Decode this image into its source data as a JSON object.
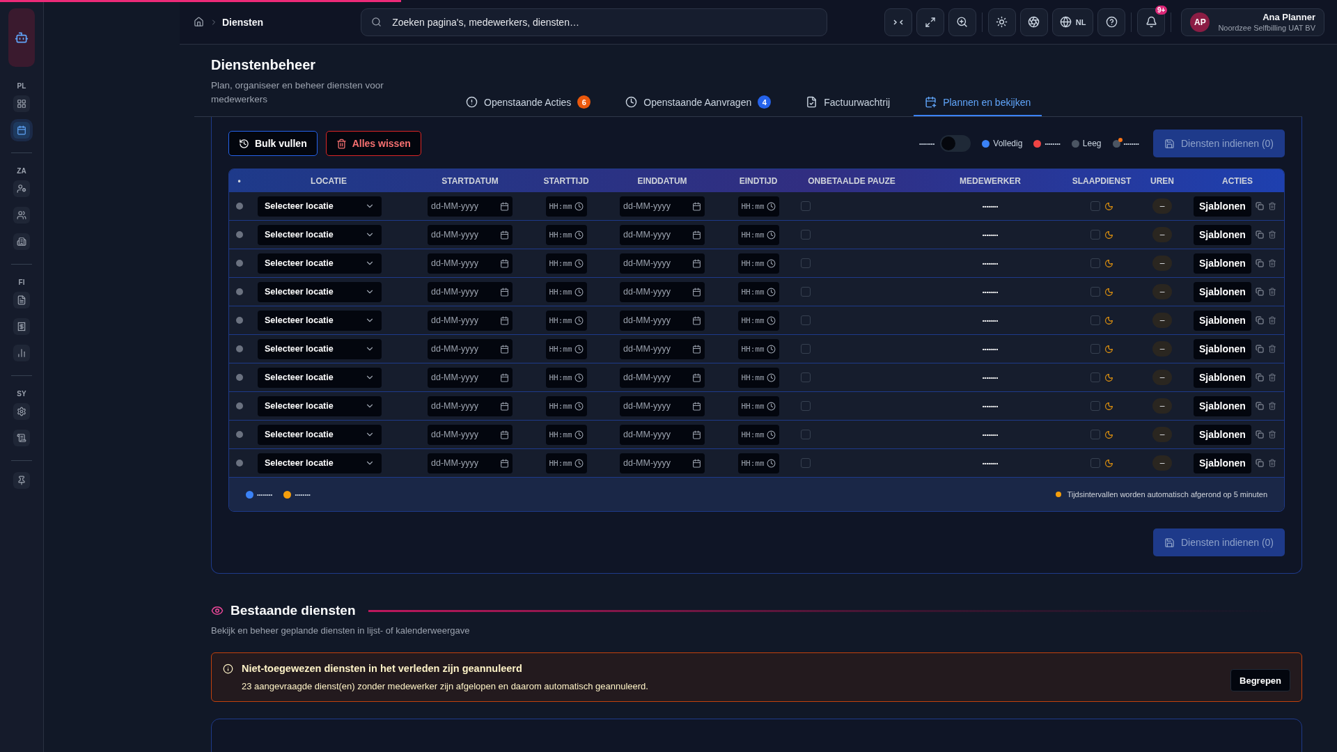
{
  "loading_bar": {
    "level": 0.3
  },
  "breadcrumb": {
    "current": "Diensten"
  },
  "search": {
    "placeholder": "Zoeken pagina's, medewerkers, diensten…"
  },
  "top_actions": {
    "language": "NL",
    "notification_badge": "9+"
  },
  "user": {
    "initials": "AP",
    "name": "Ana Planner",
    "company": "Noordzee Selfbilling UAT BV"
  },
  "sidebar": {
    "groups": [
      {
        "label": "PL",
        "items": [
          {
            "selected": false
          },
          {
            "selected": true
          }
        ]
      },
      {
        "label": "ZA",
        "items": [
          {
            "selected": false
          },
          {
            "selected": false
          },
          {
            "selected": false
          }
        ]
      },
      {
        "label": "FI",
        "items": [
          {
            "selected": false
          },
          {
            "selected": false
          },
          {
            "selected": false
          }
        ]
      },
      {
        "label": "SY",
        "items": [
          {
            "selected": false
          },
          {
            "selected": false
          }
        ]
      }
    ]
  },
  "page": {
    "title": "Dienstenbeheer",
    "subtitle": "Plan, organiseer en beheer diensten voor medewerkers"
  },
  "tabs": [
    {
      "label": "Openstaande Acties",
      "badge": "6",
      "color": "#ea580c",
      "selected": false
    },
    {
      "label": "Openstaande Aanvragen",
      "badge": "4",
      "color": "#2563eb",
      "selected": false
    },
    {
      "label": "Factuurwachtrij",
      "selected": false
    },
    {
      "label": "Plannen en bekijken",
      "selected": true
    }
  ],
  "planner": {
    "bulk_button": "Bulk vullen",
    "clear_button": "Alles wissen",
    "toggle": {
      "label": "••••••••",
      "on": false
    },
    "legend": [
      {
        "label": "Volledig",
        "color": "#3b82f6",
        "kind": "dot"
      },
      {
        "label": "••••••••",
        "color": "#ef4444",
        "kind": "dot"
      },
      {
        "label": "Leeg",
        "color": "#4b5563",
        "kind": "dot"
      },
      {
        "label": "••••••••",
        "color": "#4b5563",
        "kind": "flagged"
      }
    ],
    "submit_button": {
      "label": "Diensten indienen (0)",
      "disabled": true
    },
    "columns": [
      "•",
      "LOCATIE",
      "STARTDATUM",
      "STARTTIJD",
      "EINDDATUM",
      "EINDTIJD",
      "ONBETAALDE PAUZE",
      "MEDEWERKER",
      "SLAAPDIENST",
      "UREN",
      "ACTIES"
    ],
    "rows": [
      {
        "location": "Selecteer locatie",
        "start_date": {
          "placeholder": "dd-MM-yyyy"
        },
        "start_time": {
          "placeholder": "HH:mm"
        },
        "end_date": {
          "placeholder": "dd-MM-yyyy"
        },
        "end_time": {
          "placeholder": "HH:mm"
        },
        "unpaid_break": false,
        "employee": "••••••••",
        "sleep_shift": false,
        "hours": "–",
        "action": "Sjablonen"
      },
      {
        "location": "Selecteer locatie",
        "start_date": {
          "placeholder": "dd-MM-yyyy"
        },
        "start_time": {
          "placeholder": "HH:mm"
        },
        "end_date": {
          "placeholder": "dd-MM-yyyy"
        },
        "end_time": {
          "placeholder": "HH:mm"
        },
        "unpaid_break": false,
        "employee": "••••••••",
        "sleep_shift": false,
        "hours": "–",
        "action": "Sjablonen"
      },
      {
        "location": "Selecteer locatie",
        "start_date": {
          "placeholder": "dd-MM-yyyy"
        },
        "start_time": {
          "placeholder": "HH:mm"
        },
        "end_date": {
          "placeholder": "dd-MM-yyyy"
        },
        "end_time": {
          "placeholder": "HH:mm"
        },
        "unpaid_break": false,
        "employee": "••••••••",
        "sleep_shift": false,
        "hours": "–",
        "action": "Sjablonen"
      },
      {
        "location": "Selecteer locatie",
        "start_date": {
          "placeholder": "dd-MM-yyyy"
        },
        "start_time": {
          "placeholder": "HH:mm"
        },
        "end_date": {
          "placeholder": "dd-MM-yyyy"
        },
        "end_time": {
          "placeholder": "HH:mm"
        },
        "unpaid_break": false,
        "employee": "••••••••",
        "sleep_shift": false,
        "hours": "–",
        "action": "Sjablonen"
      },
      {
        "location": "Selecteer locatie",
        "start_date": {
          "placeholder": "dd-MM-yyyy"
        },
        "start_time": {
          "placeholder": "HH:mm"
        },
        "end_date": {
          "placeholder": "dd-MM-yyyy"
        },
        "end_time": {
          "placeholder": "HH:mm"
        },
        "unpaid_break": false,
        "employee": "••••••••",
        "sleep_shift": false,
        "hours": "–",
        "action": "Sjablonen"
      },
      {
        "location": "Selecteer locatie",
        "start_date": {
          "placeholder": "dd-MM-yyyy"
        },
        "start_time": {
          "placeholder": "HH:mm"
        },
        "end_date": {
          "placeholder": "dd-MM-yyyy"
        },
        "end_time": {
          "placeholder": "HH:mm"
        },
        "unpaid_break": false,
        "employee": "••••••••",
        "sleep_shift": false,
        "hours": "–",
        "action": "Sjablonen"
      },
      {
        "location": "Selecteer locatie",
        "start_date": {
          "placeholder": "dd-MM-yyyy"
        },
        "start_time": {
          "placeholder": "HH:mm"
        },
        "end_date": {
          "placeholder": "dd-MM-yyyy"
        },
        "end_time": {
          "placeholder": "HH:mm"
        },
        "unpaid_break": false,
        "employee": "••••••••",
        "sleep_shift": false,
        "hours": "–",
        "action": "Sjablonen"
      },
      {
        "location": "Selecteer locatie",
        "start_date": {
          "placeholder": "dd-MM-yyyy"
        },
        "start_time": {
          "placeholder": "HH:mm"
        },
        "end_date": {
          "placeholder": "dd-MM-yyyy"
        },
        "end_time": {
          "placeholder": "HH:mm"
        },
        "unpaid_break": false,
        "employee": "••••••••",
        "sleep_shift": false,
        "hours": "–",
        "action": "Sjablonen"
      },
      {
        "location": "Selecteer locatie",
        "start_date": {
          "placeholder": "dd-MM-yyyy"
        },
        "start_time": {
          "placeholder": "HH:mm"
        },
        "end_date": {
          "placeholder": "dd-MM-yyyy"
        },
        "end_time": {
          "placeholder": "HH:mm"
        },
        "unpaid_break": false,
        "employee": "••••••••",
        "sleep_shift": false,
        "hours": "–",
        "action": "Sjablonen"
      },
      {
        "location": "Selecteer locatie",
        "start_date": {
          "placeholder": "dd-MM-yyyy"
        },
        "start_time": {
          "placeholder": "HH:mm"
        },
        "end_date": {
          "placeholder": "dd-MM-yyyy"
        },
        "end_time": {
          "placeholder": "HH:mm"
        },
        "unpaid_break": false,
        "employee": "••••••••",
        "sleep_shift": false,
        "hours": "–",
        "action": "Sjablonen"
      }
    ],
    "footer_legend": [
      {
        "label": "••••••••",
        "color": "#3b82f6"
      },
      {
        "label": "••••••••",
        "color": "#f59e0b"
      }
    ],
    "footer_note": {
      "text": "Tijdsintervallen worden automatisch afgerond op 5 minuten",
      "color": "#f59e0b"
    },
    "bottom_submit_button": {
      "label": "Diensten indienen (0)",
      "disabled": true
    }
  },
  "existing": {
    "title": "Bestaande diensten",
    "subtitle": "Bekijk en beheer geplande diensten in lijst- of kalenderweergave"
  },
  "alert": {
    "title": "Niet-toegewezen diensten in het verleden zijn geannuleerd",
    "message": "23 aangevraagde dienst(en) zonder medewerker zijn afgelopen en daarom automatisch geannuleerd.",
    "button": "Begrepen"
  }
}
